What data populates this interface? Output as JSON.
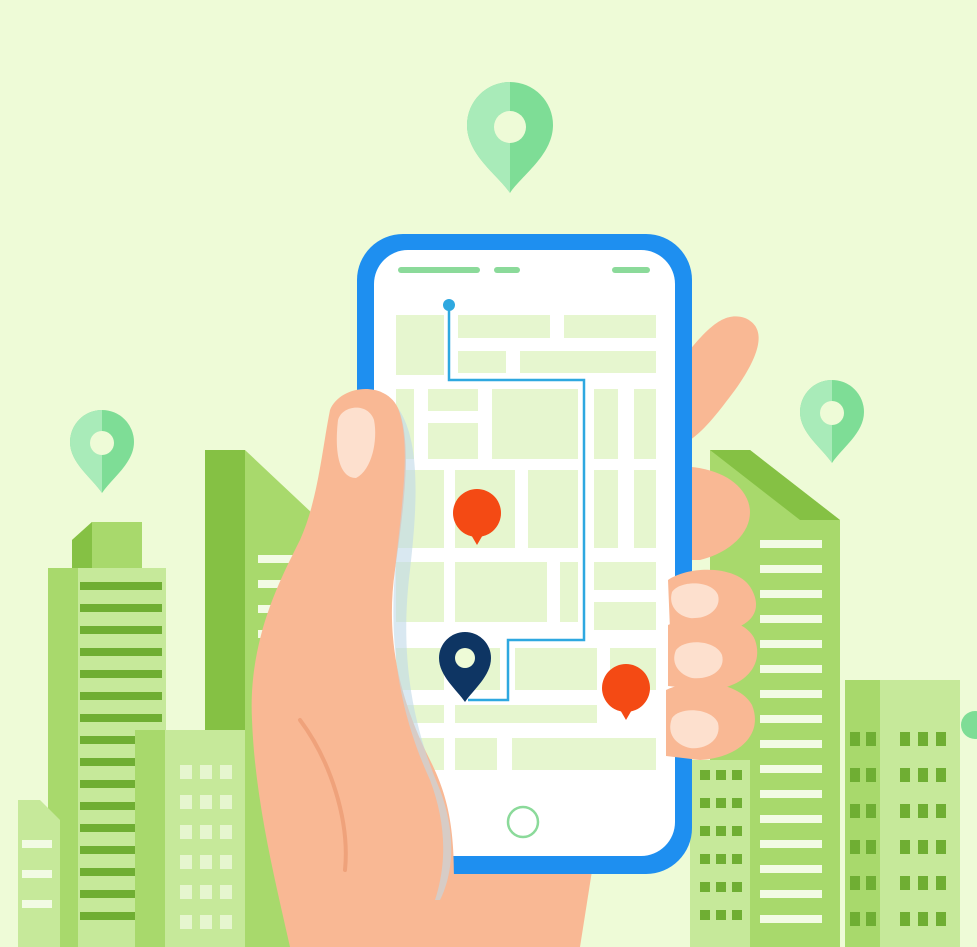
{
  "colors": {
    "sky": "#EEFBD7",
    "building_dark": "#85C144",
    "building_mid": "#A8D96C",
    "building_light": "#C6E99A",
    "window_light": "#F2FBE4",
    "window_dark": "#6FAE33",
    "pin_green": "#7EDD96",
    "pin_green_light": "#A9EBB9",
    "phone_frame": "#1E8FF0",
    "screen_bg": "#FFFFFF",
    "map_block": "#E6F6CF",
    "route": "#2EA8E0",
    "pin_red": "#F44A14",
    "pin_navy": "#0E3563",
    "skin": "#F9B894",
    "skin_shade": "#EFA27B",
    "nail": "#FDE0CE",
    "status_bar": "#8BDA9A"
  },
  "icons": [
    "map-pin-icon",
    "home-button-icon"
  ]
}
